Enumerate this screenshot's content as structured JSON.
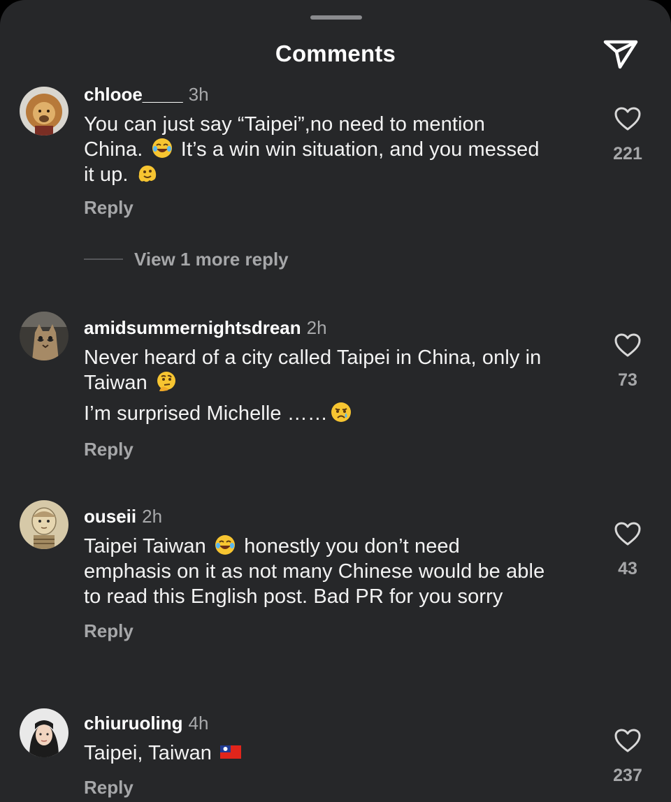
{
  "header": {
    "title": "Comments",
    "share_icon": "send-icon"
  },
  "comments": [
    {
      "username": "chlooe____",
      "time": "3h",
      "avatar_icon": "lion-avatar",
      "lines": [
        {
          "before": "You can just say “Taipei”,no need to mention China.",
          "emoji": "laughing-tears-emoji",
          "after": "It’s a win win situation, and you messed it up.",
          "emoji2": "melting-face-emoji"
        }
      ],
      "reply_label": "Reply",
      "likes": "221",
      "view_more": "View 1 more reply"
    },
    {
      "username": "amidsummernightsdrean",
      "time": "2h",
      "avatar_icon": "cat-avatar",
      "line1_text": "Never heard of a city called Taipei in China, only in Taiwan",
      "line1_emoji": "thinking-face-emoji",
      "line2_text": "I’m surprised Michelle ……",
      "line2_emoji": "crying-face-emoji",
      "reply_label": "Reply",
      "likes": "73"
    },
    {
      "username": "ouseii",
      "time": "2h",
      "avatar_icon": "doll-avatar",
      "text_before": "Taipei Taiwan",
      "emoji": "laughing-tears-emoji",
      "text_after": "honestly you don’t need emphasis on it as not many Chinese would be able to read this English post. Bad PR for you sorry",
      "reply_label": "Reply",
      "likes": "43"
    },
    {
      "username": "chiuruoling",
      "time": "4h",
      "avatar_icon": "person-avatar",
      "text": "Taipei, Taiwan",
      "emoji": "taiwan-flag-emoji",
      "reply_label": "Reply",
      "likes": "237"
    }
  ],
  "colors": {
    "background": "#262729",
    "text": "#f3f3f3",
    "secondary": "#a6a7a9"
  }
}
